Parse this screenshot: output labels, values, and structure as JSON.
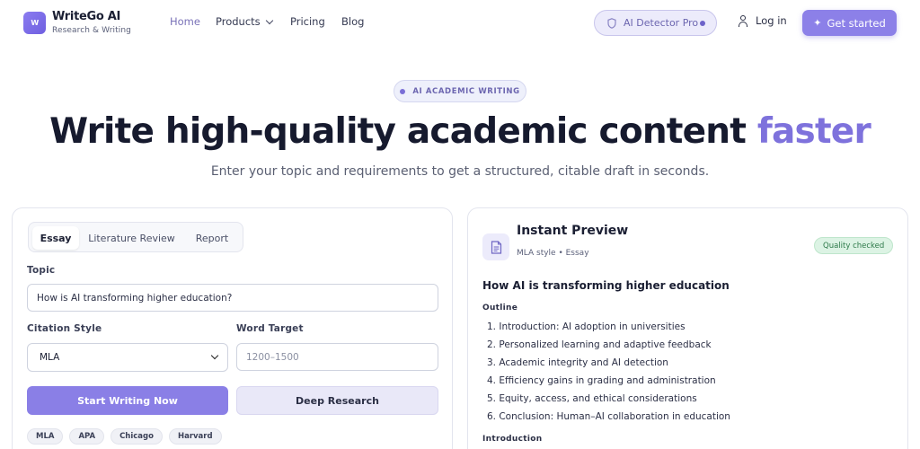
{
  "nav": {
    "logo_text": "W",
    "brand": "WriteGo AI",
    "tagline": "Research & Writing",
    "links": [
      {
        "label": "Home",
        "active": true
      },
      {
        "label": "Products",
        "active": false
      },
      {
        "label": "Pricing",
        "active": false
      },
      {
        "label": "Blog",
        "active": false
      }
    ],
    "detector": "AI Detector Pro",
    "login": "Log in",
    "cta": "Get started",
    "accent_color": "#8c80e8"
  },
  "hero": {
    "badge": "AI ACADEMIC WRITING",
    "title_main": "Write high-quality academic content ",
    "title_accent": "faster",
    "subtitle": "Enter your topic and requirements to get a structured, citable draft in seconds."
  },
  "form": {
    "tabs": [
      "Essay",
      "Literature Review",
      "Report"
    ],
    "active_tab": "Essay",
    "topic_label": "Topic",
    "topic_value": "How is AI transforming higher education?",
    "citation_label": "Citation Style",
    "citation_value": "MLA",
    "word_label": "Word Target",
    "word_placeholder": "1200–1500",
    "start_button": "Start Writing Now",
    "deep_button": "Deep Research",
    "styles": [
      "MLA",
      "APA",
      "Chicago",
      "Harvard"
    ]
  },
  "preview": {
    "title": "Instant Preview",
    "meta": "MLA style • Essay",
    "quality": "Quality checked",
    "doc_title": "How AI is transforming higher education",
    "outline_label": "Outline",
    "outline": [
      "1. Introduction: AI adoption in universities",
      "2. Personalized learning and adaptive feedback",
      "3. Academic integrity and AI detection",
      "4. Efficiency gains in grading and administration",
      "5. Equity, access, and ethical considerations",
      "6. Conclusion: Human–AI collaboration in education"
    ],
    "intro_label": "Introduction"
  }
}
